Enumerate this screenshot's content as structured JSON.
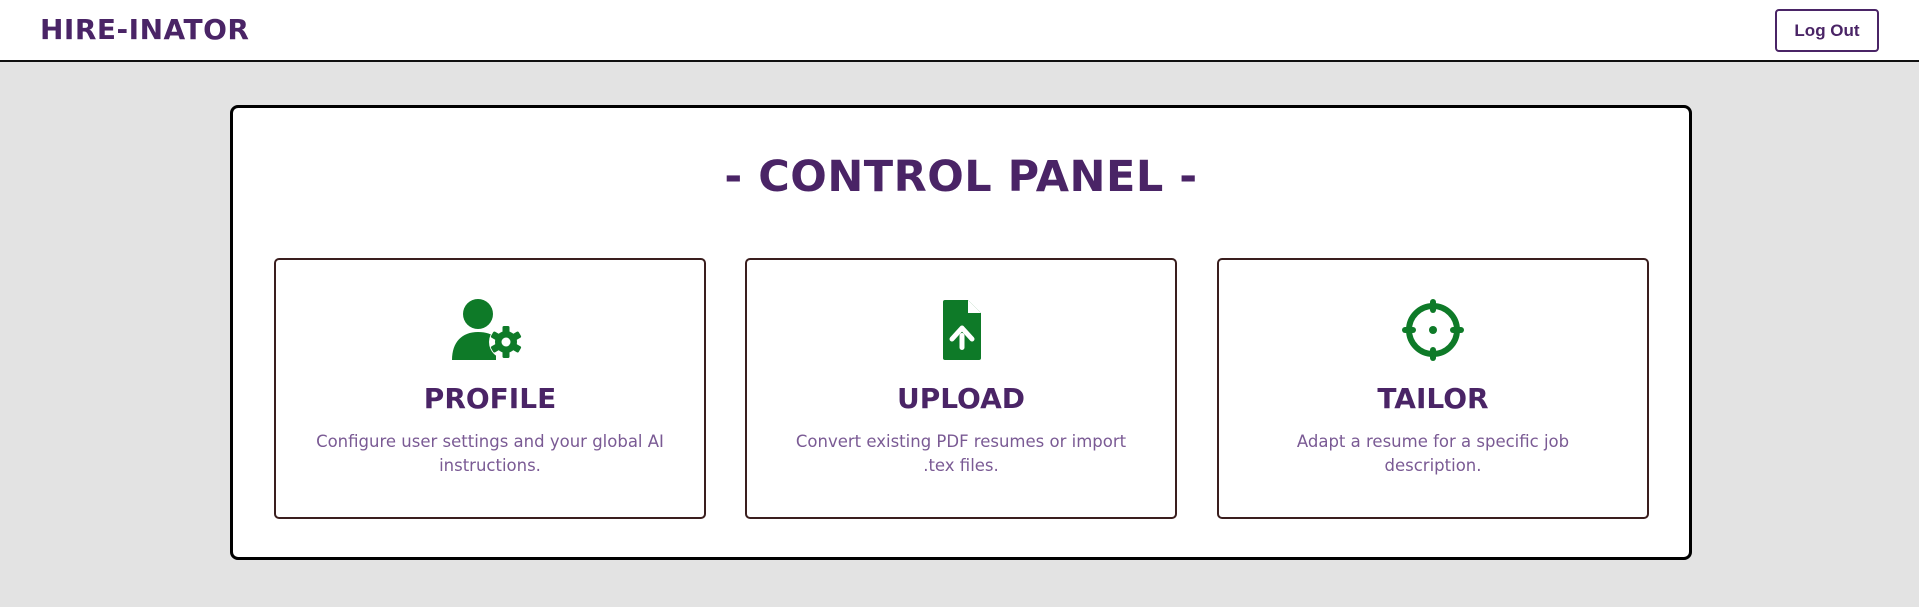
{
  "header": {
    "brand": "HIRE-INATOR",
    "logout_label": "Log Out"
  },
  "panel": {
    "title": "- CONTROL PANEL -"
  },
  "cards": [
    {
      "title": "PROFILE",
      "description": "Configure user settings and your global AI instructions.",
      "icon": "user-gear-icon"
    },
    {
      "title": "UPLOAD",
      "description": "Convert existing PDF resumes or import .tex files.",
      "icon": "file-upload-icon"
    },
    {
      "title": "TAILOR",
      "description": "Adapt a resume for a specific job description.",
      "icon": "crosshair-icon"
    }
  ],
  "colors": {
    "brand_purple": "#4a2466",
    "icon_green": "#0e7a28",
    "description_purple": "#7a5a94",
    "background": "#e3e3e3"
  }
}
